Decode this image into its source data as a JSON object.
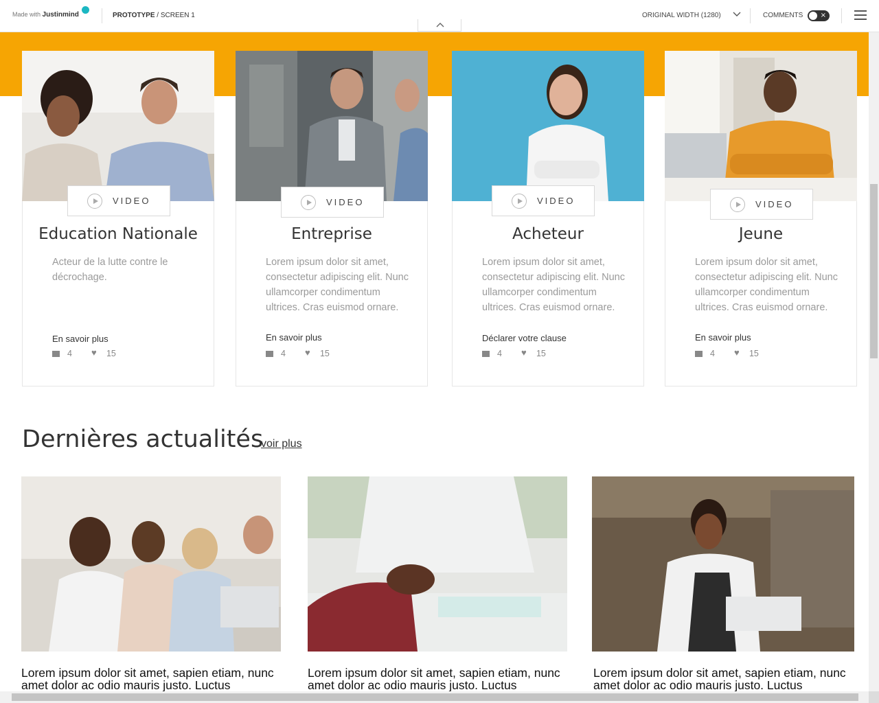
{
  "topbar": {
    "brand_prefix": "Made with",
    "brand_name": "Justinmind",
    "crumb_project": "PROTOTYPE",
    "crumb_separator": " / ",
    "crumb_screen": "SCREEN 1",
    "width_label": "ORIGINAL WIDTH (1280)",
    "comments_label": "COMMENTS",
    "comments_toggle_glyph": "×",
    "brand_accent": "#1bb7c2"
  },
  "hero": {
    "band_color": "#f6a503"
  },
  "cards": [
    {
      "video_label": "VIDEO",
      "title": "Education Nationale",
      "description": "Acteur de la lutte contre le décrochage.",
      "link": "En savoir plus",
      "comments": "4",
      "likes": "15"
    },
    {
      "video_label": "VIDEO",
      "title": "Entreprise",
      "description": "Lorem ipsum dolor sit amet, consectetur adipiscing elit. Nunc ullamcorper condimentum ultrices. Cras euismod ornare.",
      "link": "En savoir plus",
      "comments": "4",
      "likes": "15"
    },
    {
      "video_label": "VIDEO",
      "title": "Acheteur",
      "description": "Lorem ipsum dolor sit amet, consectetur adipiscing elit. Nunc ullamcorper condimentum ultrices. Cras euismod ornare.",
      "link": "Déclarer votre clause",
      "comments": "4",
      "likes": "15"
    },
    {
      "video_label": "VIDEO",
      "title": "Jeune",
      "description": "Lorem ipsum dolor sit amet, consectetur adipiscing elit. Nunc ullamcorper condimentum ultrices. Cras euismod ornare.",
      "link": "En savoir plus",
      "comments": "4",
      "likes": "15"
    }
  ],
  "news": {
    "title": "Dernières actualités",
    "more_link": "voir plus",
    "items": [
      {
        "text": "Lorem ipsum dolor sit amet, sapien etiam, nunc amet dolor ac odio mauris justo. Luctus"
      },
      {
        "text": "Lorem ipsum dolor sit amet, sapien etiam, nunc amet dolor ac odio mauris justo. Luctus"
      },
      {
        "text": "Lorem ipsum dolor sit amet, sapien etiam, nunc amet dolor ac odio mauris justo. Luctus"
      }
    ]
  }
}
